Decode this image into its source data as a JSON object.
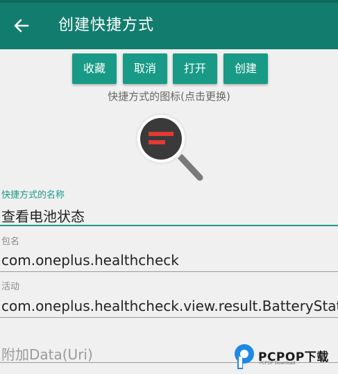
{
  "app_bar": {
    "title": "创建快捷方式",
    "back_icon": "arrow-left-icon",
    "color": "#127d6e"
  },
  "toolbar": {
    "buttons": [
      {
        "label": "收藏"
      },
      {
        "label": "取消"
      },
      {
        "label": "打开"
      },
      {
        "label": "创建"
      }
    ],
    "color": "#189a86"
  },
  "icon_section": {
    "hint": "快捷方式的图标(点击更换)",
    "icon": "magnifier-list-icon"
  },
  "form": {
    "name": {
      "label": "快捷方式的名称",
      "value": "查看电池状态"
    },
    "package": {
      "label": "包名",
      "value": "com.oneplus.healthcheck"
    },
    "activity": {
      "label": "活动",
      "value": "com.oneplus.healthcheck.view.result.BatteryStatus"
    },
    "extra_data": {
      "placeholder": "附加Data(Uri)"
    }
  },
  "watermark": {
    "text": "PCPOP下载",
    "subtext": "PCPOP Download"
  },
  "accent": "#1a9a87"
}
